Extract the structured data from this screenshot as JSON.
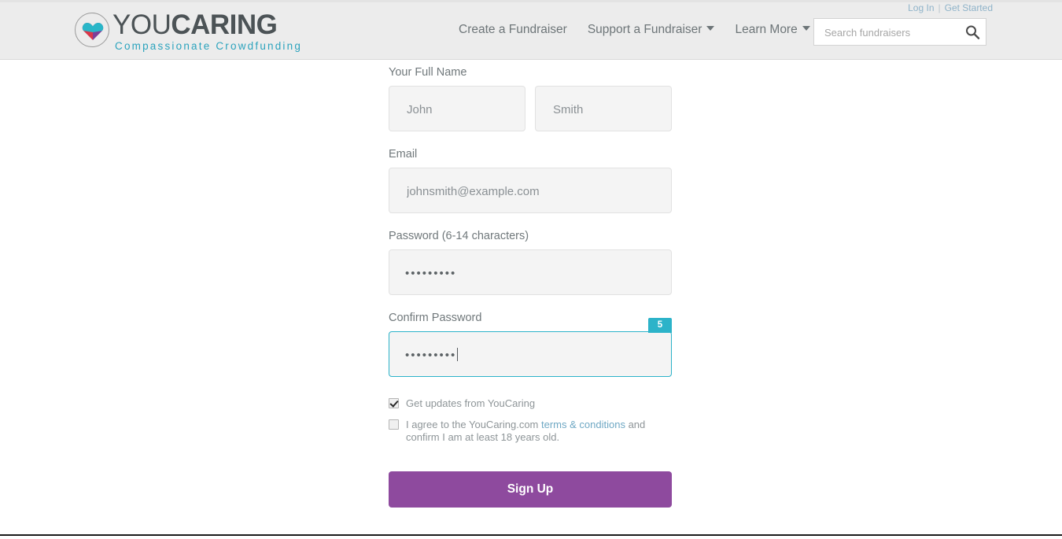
{
  "header": {
    "logo": {
      "mark": "heart-in-circle-icon",
      "word_you": "YOU",
      "word_caring": "CARING",
      "tagline": "Compassionate Crowdfunding",
      "colors": {
        "heart_top": "#29b6c8",
        "heart_left": "#d9384a",
        "heart_right": "#7e3f98",
        "wordmark": "#4c5356",
        "tagline": "#2ba3bd"
      }
    },
    "top_links": [
      {
        "label": "Log In"
      },
      {
        "label": "Get Started"
      }
    ],
    "nav": [
      {
        "label": "Create a Fundraiser",
        "has_caret": false
      },
      {
        "label": "Support a Fundraiser",
        "has_caret": true
      },
      {
        "label": "Learn More",
        "has_caret": true
      }
    ],
    "search": {
      "placeholder": "Search fundraisers",
      "value": "",
      "icon": "search-icon"
    }
  },
  "form": {
    "full_name": {
      "label": "Your Full Name",
      "first": {
        "placeholder": "John",
        "value": ""
      },
      "last": {
        "placeholder": "Smith",
        "value": ""
      }
    },
    "email": {
      "label": "Email",
      "placeholder": "johnsmith@example.com",
      "value": ""
    },
    "password": {
      "label": "Password (6-14 characters)",
      "masked_value": "•••••••••"
    },
    "confirm_password": {
      "label": "Confirm Password",
      "masked_value": "•••••••••",
      "counter_badge": "5",
      "focused": true,
      "focus_color": "#2cb3c9"
    },
    "checkboxes": [
      {
        "label": "Get updates from YouCaring",
        "checked": true
      },
      {
        "label_before_link": "I agree to the YouCaring.com ",
        "link_text": "terms & conditions",
        "label_after_link": " and confirm I am at least 18 years old.",
        "checked": false
      }
    ],
    "submit": {
      "label": "Sign Up",
      "color": "#8e4a9e"
    }
  }
}
